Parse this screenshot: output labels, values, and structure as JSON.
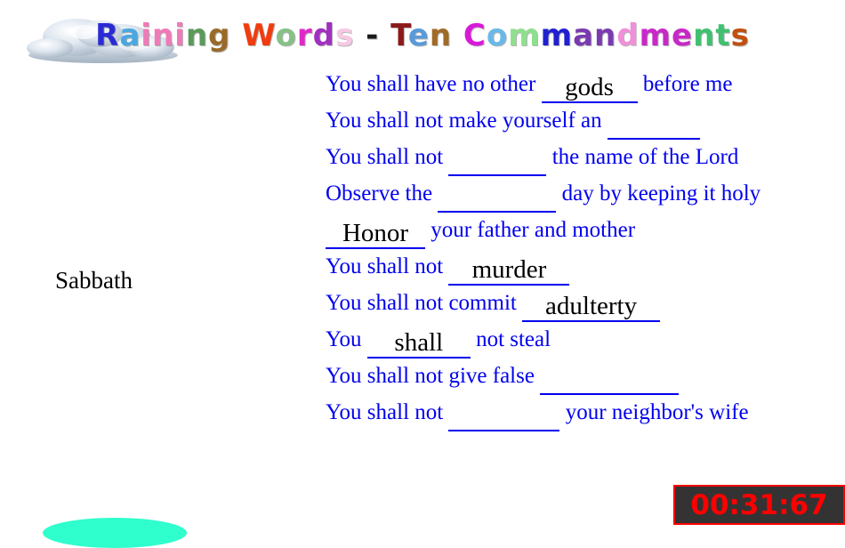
{
  "app": {
    "title_text": "Raining Words - Ten Commandments",
    "title_letters": [
      {
        "c": "R",
        "color": "#2b2bd4"
      },
      {
        "c": "a",
        "color": "#4aa8e0"
      },
      {
        "c": "i",
        "color": "#f07ab8"
      },
      {
        "c": "n",
        "color": "#f07ab8"
      },
      {
        "c": "i",
        "color": "#f07ab8"
      },
      {
        "c": "n",
        "color": "#5a9b5a"
      },
      {
        "c": "g",
        "color": "#9a6a2a"
      },
      {
        "c": " ",
        "color": "#000000"
      },
      {
        "c": "W",
        "color": "#f03c10"
      },
      {
        "c": "o",
        "color": "#87c187"
      },
      {
        "c": "r",
        "color": "#e028c8"
      },
      {
        "c": "d",
        "color": "#a030c0"
      },
      {
        "c": "s",
        "color": "#f7c8e4"
      },
      {
        "c": " ",
        "color": "#000000"
      },
      {
        "c": "-",
        "color": "#1a1a1a"
      },
      {
        "c": " ",
        "color": "#000000"
      },
      {
        "c": "T",
        "color": "#8b1a1a"
      },
      {
        "c": "e",
        "color": "#5a9ad8"
      },
      {
        "c": "n",
        "color": "#a06a28"
      },
      {
        "c": " ",
        "color": "#000000"
      },
      {
        "c": "C",
        "color": "#d81ad8"
      },
      {
        "c": "o",
        "color": "#6ab8e8"
      },
      {
        "c": "m",
        "color": "#8ee08e"
      },
      {
        "c": "m",
        "color": "#2020d0"
      },
      {
        "c": "a",
        "color": "#7a3ab0"
      },
      {
        "c": "n",
        "color": "#7a3ab0"
      },
      {
        "c": "d",
        "color": "#f090d8"
      },
      {
        "c": "m",
        "color": "#c828c8"
      },
      {
        "c": "e",
        "color": "#c828c8"
      },
      {
        "c": "n",
        "color": "#40c070"
      },
      {
        "c": "t",
        "color": "#40c070"
      },
      {
        "c": "s",
        "color": "#c05010"
      }
    ]
  },
  "falling_word": {
    "label": "Sabbath"
  },
  "timer": {
    "value": "00:31:67",
    "digit_color": "#ff0000",
    "background_color": "#333333",
    "border_color": "#ff0000"
  },
  "colors": {
    "prompt_text": "#0000ee",
    "answer_text": "#000000",
    "bucket": "#2fffcc"
  },
  "puzzle": {
    "lines": [
      {
        "id": "commandment-1",
        "segments": [
          {
            "type": "text",
            "value": "You shall have no other "
          },
          {
            "type": "blank",
            "value": "gods",
            "width": 108
          },
          {
            "type": "text",
            "value": " before me"
          }
        ]
      },
      {
        "id": "commandment-2",
        "segments": [
          {
            "type": "text",
            "value": "You shall not make yourself an "
          },
          {
            "type": "blank",
            "value": "",
            "width": 104
          }
        ]
      },
      {
        "id": "commandment-3",
        "segments": [
          {
            "type": "text",
            "value": "You shall not "
          },
          {
            "type": "blank",
            "value": "",
            "width": 110
          },
          {
            "type": "text",
            "value": " the name of the Lord"
          }
        ]
      },
      {
        "id": "commandment-4",
        "segments": [
          {
            "type": "text",
            "value": "Observe the "
          },
          {
            "type": "blank",
            "value": "",
            "width": 133
          },
          {
            "type": "text",
            "value": " day by keeping it holy"
          }
        ]
      },
      {
        "id": "commandment-5",
        "segments": [
          {
            "type": "blank",
            "value": "Honor",
            "width": 112
          },
          {
            "type": "text",
            "value": " your father and mother"
          }
        ]
      },
      {
        "id": "commandment-6",
        "segments": [
          {
            "type": "text",
            "value": "You shall not "
          },
          {
            "type": "blank",
            "value": "murder",
            "width": 136
          }
        ]
      },
      {
        "id": "commandment-7",
        "segments": [
          {
            "type": "text",
            "value": "You shall not commit "
          },
          {
            "type": "blank",
            "value": "adulterty",
            "width": 155
          }
        ]
      },
      {
        "id": "commandment-8",
        "segments": [
          {
            "type": "text",
            "value": "You "
          },
          {
            "type": "blank",
            "value": "shall",
            "width": 116
          },
          {
            "type": "text",
            "value": " not steal"
          }
        ]
      },
      {
        "id": "commandment-9",
        "segments": [
          {
            "type": "text",
            "value": "You shall not give false "
          },
          {
            "type": "blank",
            "value": "",
            "width": 156
          }
        ]
      },
      {
        "id": "commandment-10",
        "segments": [
          {
            "type": "text",
            "value": "You shall not "
          },
          {
            "type": "blank",
            "value": "",
            "width": 125
          },
          {
            "type": "text",
            "value": " your neighbor's wife"
          }
        ]
      }
    ]
  }
}
